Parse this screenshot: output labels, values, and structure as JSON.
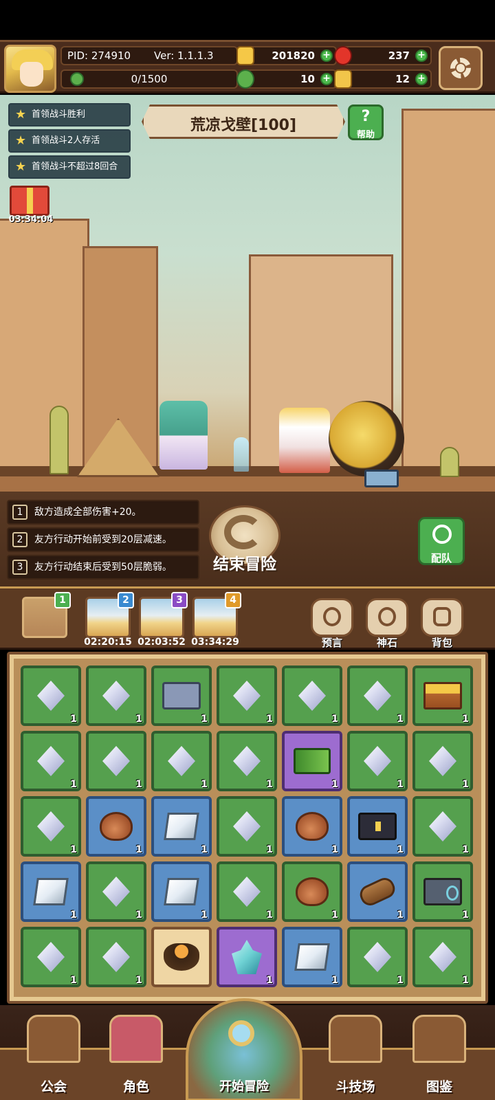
{
  "header": {
    "pid_label": "PID: 274910",
    "version_label": "Ver: 1.1.1.3",
    "exp_text": "0/1500",
    "exp_progress": 0,
    "coins": "201820",
    "gems": "237",
    "clovers": "10",
    "keys": "12"
  },
  "quests": [
    "首领战斗胜利",
    "首领战斗2人存活",
    "首领战斗不超过8回合"
  ],
  "stage": {
    "title": "荒凉戈壁[100]",
    "help_label": "帮助"
  },
  "gift": {
    "timer": "03:34:04"
  },
  "effects": [
    {
      "num": "1",
      "text": "敌方造成全部伤害+20。"
    },
    {
      "num": "2",
      "text": "友方行动开始前受到20层减速。"
    },
    {
      "num": "3",
      "text": "友方行动结束后受到50层脆弱。"
    }
  ],
  "actions": {
    "end_adventure": "结束冒险",
    "team": "配队"
  },
  "maps": [
    {
      "badge": "1",
      "timer": "",
      "badge_color": "#4caf50"
    },
    {
      "badge": "2",
      "timer": "02:20:15",
      "badge_color": "#3a8ad0"
    },
    {
      "badge": "3",
      "timer": "02:03:52",
      "badge_color": "#8a4cc4"
    },
    {
      "badge": "4",
      "timer": "03:34:29",
      "badge_color": "#e09a2a"
    }
  ],
  "side_buttons": {
    "prophecy": "预言",
    "divine_stone": "神石",
    "backpack": "背包"
  },
  "inventory": {
    "rows": [
      [
        {
          "item": "crystal",
          "color": "green",
          "count": "1"
        },
        {
          "item": "crystal",
          "color": "green",
          "count": "1"
        },
        {
          "item": "chest-silver",
          "color": "green",
          "count": "1"
        },
        {
          "item": "crystal",
          "color": "green",
          "count": "1"
        },
        {
          "item": "crystal",
          "color": "green",
          "count": "1"
        },
        {
          "item": "crystal",
          "color": "green",
          "count": "1"
        },
        {
          "item": "chest-gold",
          "color": "green",
          "count": "1"
        }
      ],
      [
        {
          "item": "crystal",
          "color": "green",
          "count": "1"
        },
        {
          "item": "crystal",
          "color": "green",
          "count": "1"
        },
        {
          "item": "crystal",
          "color": "green",
          "count": "1"
        },
        {
          "item": "crystal",
          "color": "green",
          "count": "1"
        },
        {
          "item": "green-brick",
          "color": "purple",
          "count": "1"
        },
        {
          "item": "crystal",
          "color": "green",
          "count": "1"
        },
        {
          "item": "crystal",
          "color": "green",
          "count": "1"
        }
      ],
      [
        {
          "item": "crystal",
          "color": "green",
          "count": "1"
        },
        {
          "item": "bag",
          "color": "blue",
          "count": "1"
        },
        {
          "item": "ingot",
          "color": "blue",
          "count": "1"
        },
        {
          "item": "crystal",
          "color": "green",
          "count": "1"
        },
        {
          "item": "bag",
          "color": "blue",
          "count": "1"
        },
        {
          "item": "chest-black",
          "color": "blue",
          "count": "1"
        },
        {
          "item": "crystal",
          "color": "green",
          "count": "1"
        }
      ],
      [
        {
          "item": "ingot",
          "color": "blue",
          "count": "1"
        },
        {
          "item": "crystal",
          "color": "green",
          "count": "1"
        },
        {
          "item": "ingot",
          "color": "blue",
          "count": "1"
        },
        {
          "item": "crystal",
          "color": "green",
          "count": "1"
        },
        {
          "item": "bag",
          "color": "green",
          "count": "1"
        },
        {
          "item": "log",
          "color": "blue",
          "count": "1"
        },
        {
          "item": "chest-stone",
          "color": "green",
          "count": "1"
        }
      ],
      [
        {
          "item": "crystal",
          "color": "green",
          "count": "1"
        },
        {
          "item": "crystal",
          "color": "green",
          "count": "1"
        },
        {
          "item": "pot",
          "color": "orange",
          "count": ""
        },
        {
          "item": "ice-crystal",
          "color": "purple",
          "count": "1"
        },
        {
          "item": "ingot",
          "color": "blue",
          "count": "1"
        },
        {
          "item": "crystal",
          "color": "green",
          "count": "1"
        },
        {
          "item": "crystal",
          "color": "green",
          "count": "1"
        }
      ]
    ]
  },
  "nav": {
    "guild": "公会",
    "character": "角色",
    "start_adventure": "开始冒险",
    "arena": "斗技场",
    "codex": "图鉴"
  }
}
